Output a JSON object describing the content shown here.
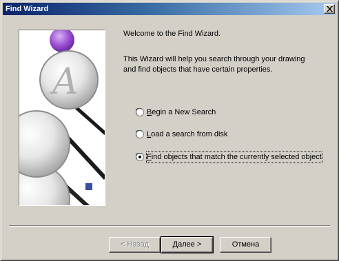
{
  "window": {
    "title": "Find Wizard"
  },
  "content": {
    "welcome": "Welcome to the Find Wizard.",
    "description_line1": "This Wizard will help you search through your drawing",
    "description_line2": "and find objects that have certain properties."
  },
  "options": [
    {
      "label_key": "B",
      "label_rest": "egin a New Search",
      "selected": false
    },
    {
      "label_key": "L",
      "label_rest": "oad a search from disk",
      "selected": false
    },
    {
      "label_key": "F",
      "label_rest": "ind objects that match the currently selected object",
      "selected": true
    }
  ],
  "buttons": {
    "back": "< Назад",
    "next_key": "Д",
    "next_rest": "алее >",
    "cancel": "Отмена"
  },
  "colors": {
    "titlebar_start": "#0a246a",
    "titlebar_end": "#a6caf0",
    "accent_purple": "#9b4fd4"
  },
  "icons": {
    "close": "close-icon",
    "illustration": "magnifying-glass-illustration"
  }
}
